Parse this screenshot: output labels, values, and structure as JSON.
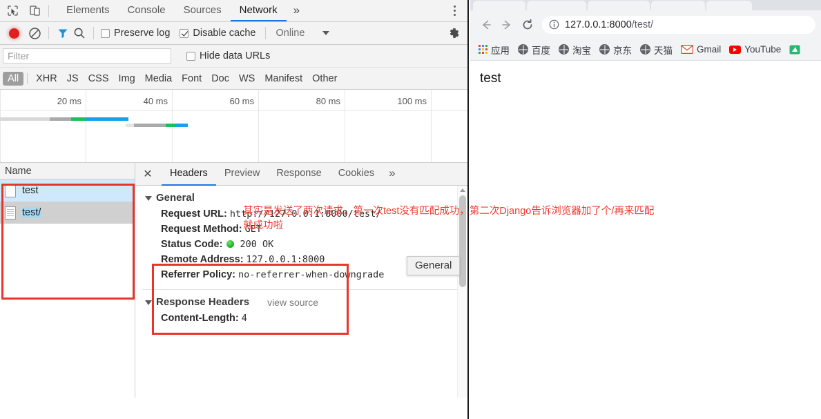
{
  "devtools": {
    "toolbar_icons": [
      "inspect-icon",
      "device-toggle-icon"
    ],
    "tabs": [
      {
        "label": "Elements",
        "active": false
      },
      {
        "label": "Console",
        "active": false
      },
      {
        "label": "Sources",
        "active": false
      },
      {
        "label": "Network",
        "active": true
      },
      {
        "label": "»",
        "active": false
      }
    ],
    "controls": {
      "record_icon": "record-icon",
      "clear_icon": "clear-icon",
      "filter_icon": "filter-icon",
      "search_icon": "search-icon",
      "preserve_log_label": "Preserve log",
      "preserve_log_checked": false,
      "disable_cache_label": "Disable cache",
      "disable_cache_checked": true,
      "throttling_label": "Online",
      "settings_icon": "gear-icon"
    },
    "filter": {
      "placeholder": "Filter",
      "value": "",
      "hide_data_urls_label": "Hide data URLs",
      "hide_data_urls_checked": false
    },
    "type_filters": [
      {
        "label": "All",
        "active": true
      },
      {
        "label": "XHR",
        "active": false
      },
      {
        "label": "JS",
        "active": false
      },
      {
        "label": "CSS",
        "active": false
      },
      {
        "label": "Img",
        "active": false
      },
      {
        "label": "Media",
        "active": false
      },
      {
        "label": "Font",
        "active": false
      },
      {
        "label": "Doc",
        "active": false
      },
      {
        "label": "WS",
        "active": false
      },
      {
        "label": "Manifest",
        "active": false
      },
      {
        "label": "Other",
        "active": false
      }
    ],
    "overview": {
      "ticks": [
        "20 ms",
        "40 ms",
        "60 ms",
        "80 ms",
        "100 ms"
      ],
      "colors": {
        "queueing": "#d8d8d8",
        "stalled": "#aaaaaa",
        "waiting": "#1bc05a",
        "download": "#1a9fea"
      }
    },
    "requests": {
      "column_header": "Name",
      "rows": [
        {
          "name": "test",
          "state": "selected"
        },
        {
          "name": "test/",
          "state": "focused"
        }
      ]
    },
    "detail": {
      "close_icon": "close-icon",
      "tabs": [
        {
          "label": "Headers",
          "active": true
        },
        {
          "label": "Preview",
          "active": false
        },
        {
          "label": "Response",
          "active": false
        },
        {
          "label": "Cookies",
          "active": false
        },
        {
          "label": "»",
          "active": false
        }
      ],
      "general_section": {
        "title": "General",
        "items": [
          {
            "key": "Request URL:",
            "value": "http://127.0.0.1:8000/test/"
          },
          {
            "key": "Request Method:",
            "value": "GET"
          },
          {
            "key": "Status Code:",
            "value": "200  OK",
            "status": "green"
          },
          {
            "key": "Remote Address:",
            "value": "127.0.0.1:8000"
          },
          {
            "key": "Referrer Policy:",
            "value": "no-referrer-when-downgrade"
          }
        ]
      },
      "response_headers_section": {
        "title": "Response Headers",
        "view_source": "view source",
        "items": [
          {
            "key": "Content-Length:",
            "value": "4"
          }
        ]
      },
      "tooltip": "General"
    }
  },
  "annotation": {
    "line1": "其实是发送了两次请求，第一次test没有匹配成功，第二次Django告诉浏览器加了个/再来匹配",
    "line2": "就成功啦",
    "color": "#ef3b30"
  },
  "browser": {
    "nav": {
      "back_icon": "back-arrow-icon",
      "forward_icon": "forward-arrow-icon",
      "reload_icon": "reload-icon",
      "info_icon": "info-circle-icon",
      "url_host": "127.0.0.1:8000",
      "url_path": "/test/"
    },
    "bookmarks": [
      {
        "label": "应用",
        "icon": "apps-grid-icon"
      },
      {
        "label": "百度",
        "icon": "globe-icon"
      },
      {
        "label": "淘宝",
        "icon": "globe-icon"
      },
      {
        "label": "京东",
        "icon": "globe-icon"
      },
      {
        "label": "天猫",
        "icon": "globe-icon"
      },
      {
        "label": "Gmail",
        "icon": "gmail-icon"
      },
      {
        "label": "YouTube",
        "icon": "youtube-icon"
      }
    ],
    "page": {
      "body_text": "test"
    }
  }
}
